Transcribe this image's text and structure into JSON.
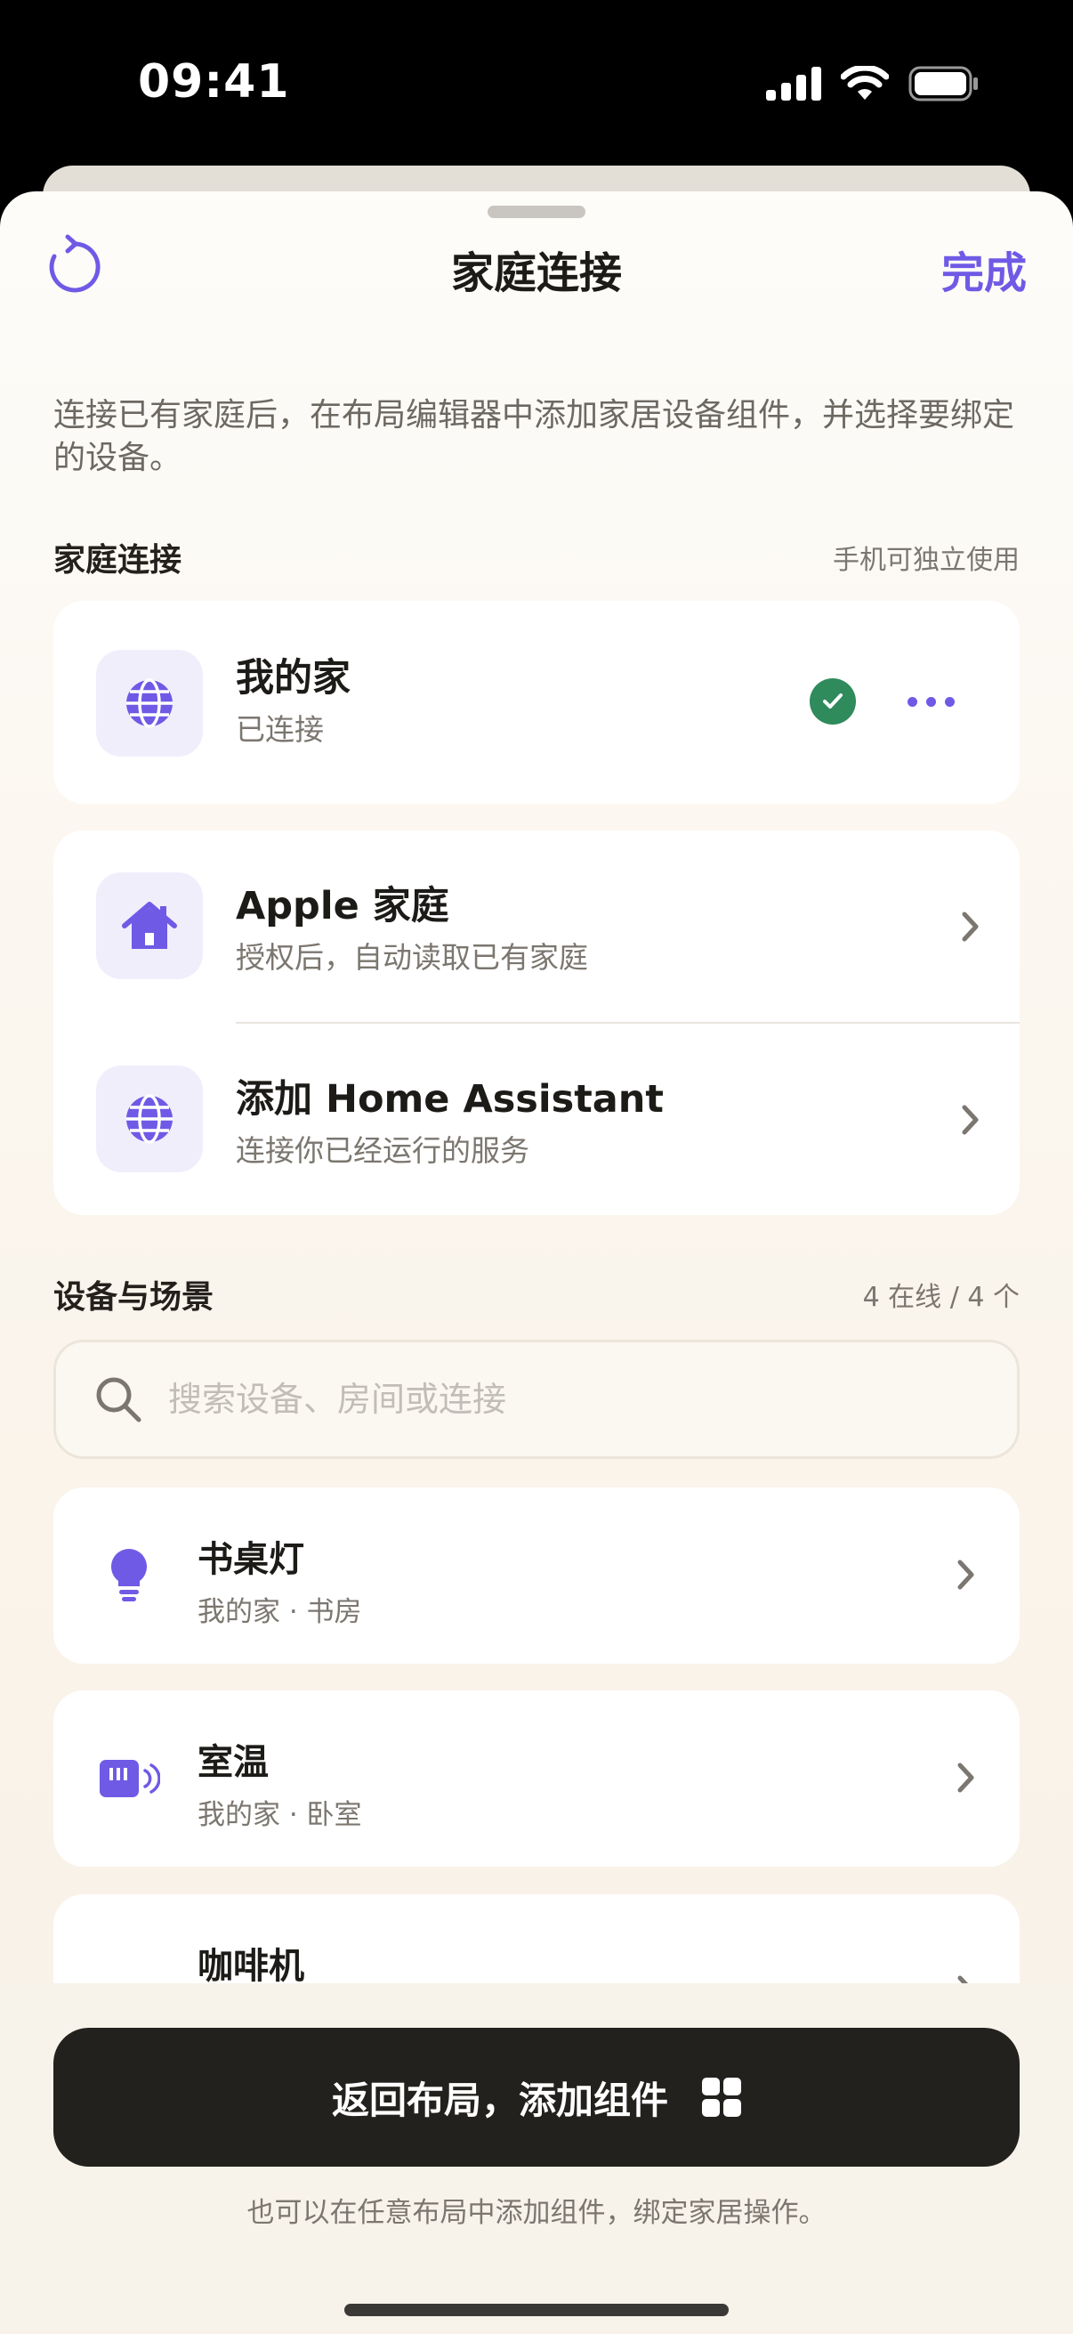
{
  "status_bar": {
    "time": "09:41"
  },
  "nav": {
    "title": "家庭连接",
    "done_label": "完成"
  },
  "intro_text": "连接已有家庭后，在布局编辑器中添加家居设备组件，并选择要绑定的设备。",
  "home_section": {
    "title": "家庭连接",
    "note": "手机可独立使用"
  },
  "connected_home": {
    "name": "我的家",
    "status": "已连接",
    "icon": "globe-icon"
  },
  "providers": [
    {
      "title": "Apple 家庭",
      "subtitle": "授权后，自动读取已有家庭",
      "icon": "house-icon"
    },
    {
      "title": "添加 Home Assistant",
      "subtitle": "连接你已经运行的服务",
      "icon": "globe-icon"
    }
  ],
  "devices_section": {
    "title": "设备与场景",
    "note": "4 在线 / 4 个"
  },
  "search": {
    "placeholder": "搜索设备、房间或连接"
  },
  "devices": [
    {
      "name": "书桌灯",
      "location": "我的家 · 书房",
      "icon": "lightbulb-icon"
    },
    {
      "name": "室温",
      "location": "我的家 · 卧室",
      "icon": "thermostat-icon"
    },
    {
      "name": "咖啡机",
      "location": "",
      "icon": "coffee-machine-icon"
    }
  ],
  "cta": {
    "label": "返回布局，添加组件",
    "icon": "widgets-grid-icon"
  },
  "footnote": "也可以在任意布局中添加组件，绑定家居操作。",
  "colors": {
    "accent": "#6f5ae6",
    "success": "#2f8a5c",
    "cta_bg": "#23211d"
  }
}
